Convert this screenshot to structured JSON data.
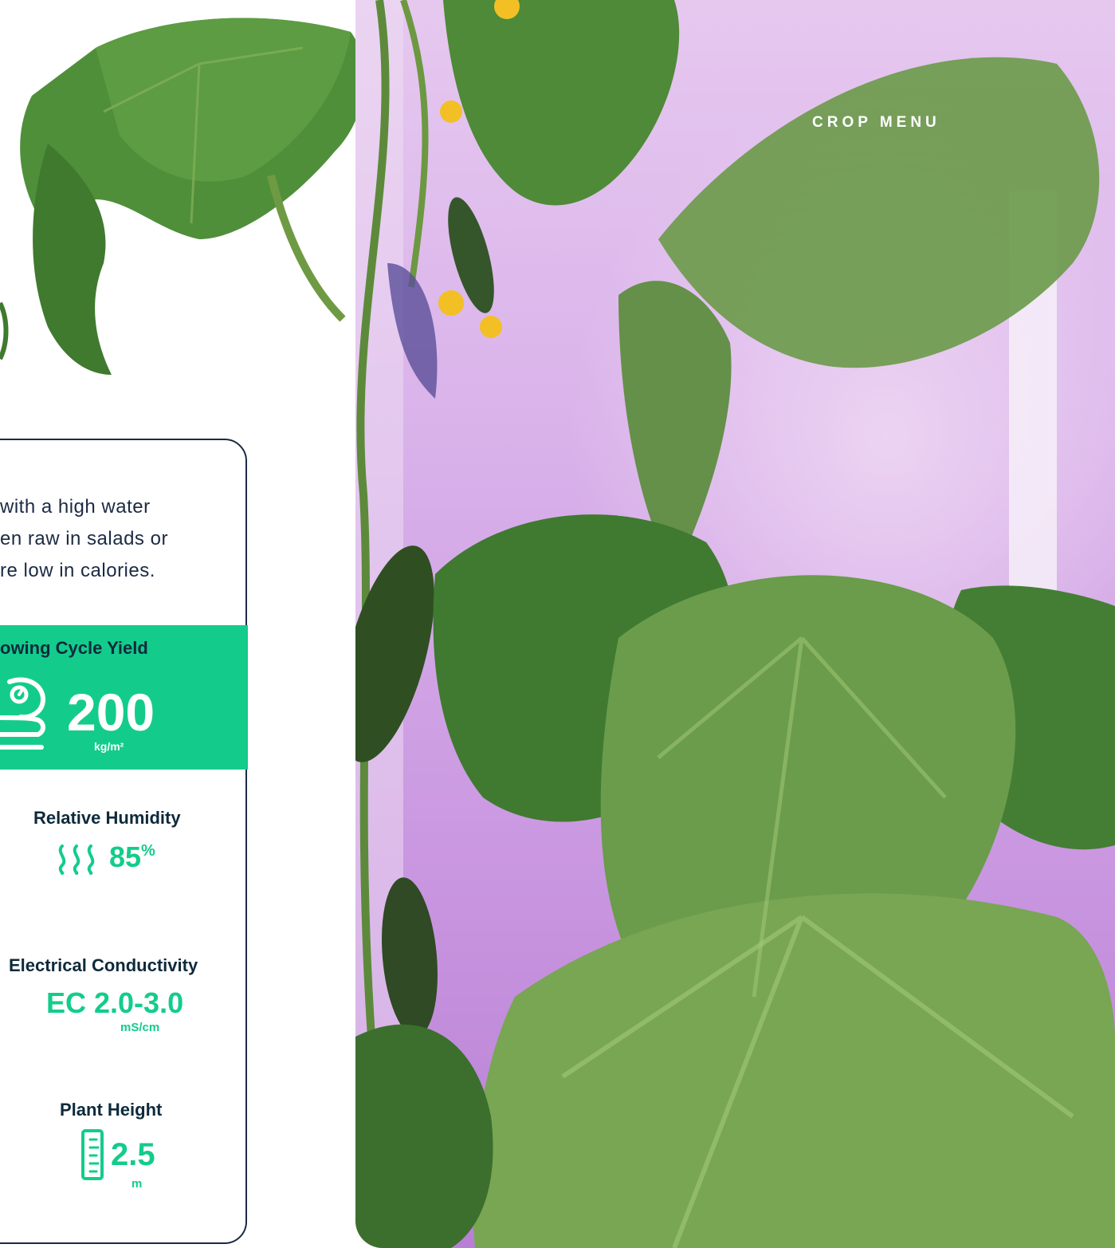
{
  "nav": {
    "crop_menu": "CROP MENU"
  },
  "description": {
    "lines": [
      "with a high water",
      "en raw in salads or",
      "re low in calories."
    ]
  },
  "yield": {
    "label": "owing Cycle Yield",
    "value": "200",
    "unit": "kg/m²",
    "icon": "scale-icon"
  },
  "humidity": {
    "label": "Relative Humidity",
    "value": "85",
    "unit": "%",
    "icon": "humidity-waves-icon"
  },
  "conductivity": {
    "label": "Electrical Conductivity",
    "value": "EC 2.0-3.0",
    "unit": "mS/cm"
  },
  "height": {
    "label": "Plant Height",
    "value": "2.5",
    "unit": "m",
    "icon": "ruler-icon"
  },
  "colors": {
    "accent": "#13cc8b",
    "navy": "#0e2a3c",
    "border": "#1b2a44"
  }
}
